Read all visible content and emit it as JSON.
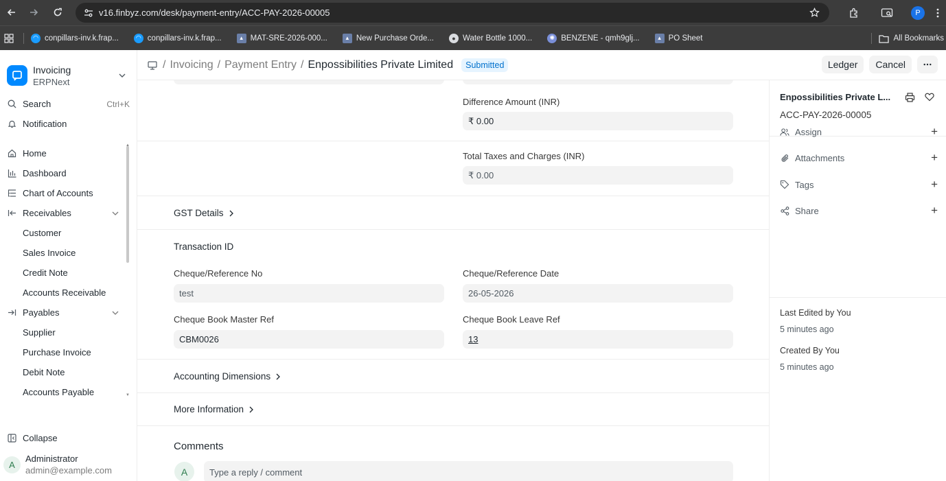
{
  "browser": {
    "url": "v16.finbyz.com/desk/payment-entry/ACC-PAY-2026-00005",
    "profile_initial": "P",
    "bookmarks": [
      {
        "label": "conpillars-inv.k.frap...",
        "color": "#1a9cff"
      },
      {
        "label": "conpillars-inv.k.frap...",
        "color": "#1a9cff"
      },
      {
        "label": "MAT-SRE-2026-000...",
        "color": "#6a7fa8"
      },
      {
        "label": "New Purchase Orde...",
        "color": "#6a7fa8"
      },
      {
        "label": "Water Bottle 1000...",
        "color": "#9aa0a6"
      },
      {
        "label": "BENZENE - qmh9glj...",
        "color": "#7a8fd8"
      },
      {
        "label": "PO Sheet",
        "color": "#6a7fa8"
      }
    ],
    "all_bookmarks": "All Bookmarks"
  },
  "sidebar": {
    "app_title": "Invoicing",
    "app_sub": "ERPNext",
    "search_label": "Search",
    "search_shortcut": "Ctrl+K",
    "notification_label": "Notification",
    "home": "Home",
    "dashboard": "Dashboard",
    "chart_of_accounts": "Chart of Accounts",
    "receivables": "Receivables",
    "receivables_items": [
      "Customer",
      "Sales Invoice",
      "Credit Note",
      "Accounts Receivable"
    ],
    "payables": "Payables",
    "payables_items": [
      "Supplier",
      "Purchase Invoice",
      "Debit Note",
      "Accounts Payable"
    ],
    "collapse": "Collapse",
    "user_initial": "A",
    "user_name": "Administrator",
    "user_email": "admin@example.com"
  },
  "header": {
    "crumb1": "Invoicing",
    "crumb2": "Payment Entry",
    "title": "Enpossibilities Private Limited",
    "status": "Submitted",
    "ledger": "Ledger",
    "cancel": "Cancel"
  },
  "form": {
    "difference_amount_label": "Difference Amount (INR)",
    "difference_amount_value": "₹ 0.00",
    "total_taxes_label": "Total Taxes and Charges (INR)",
    "total_taxes_value": "₹ 0.00",
    "gst_details": "GST Details",
    "transaction_id": "Transaction ID",
    "cheque_ref_no_label": "Cheque/Reference No",
    "cheque_ref_no_value": "test",
    "cheque_ref_date_label": "Cheque/Reference Date",
    "cheque_ref_date_value": "26-05-2026",
    "cheque_book_master_label": "Cheque Book Master Ref",
    "cheque_book_master_value": "CBM0026",
    "cheque_book_leave_label": "Cheque Book Leave Ref",
    "cheque_book_leave_value": "13",
    "accounting_dimensions": "Accounting Dimensions",
    "more_information": "More Information",
    "comments_title": "Comments",
    "comment_avatar": "A",
    "comment_placeholder": "Type a reply / comment"
  },
  "panel": {
    "title": "Enpossibilities Private L...",
    "doc_name": "ACC-PAY-2026-00005",
    "assign": "Assign",
    "attachments": "Attachments",
    "tags": "Tags",
    "share": "Share",
    "last_edited": "Last Edited by You",
    "last_edited_time": "5 minutes ago",
    "created_by": "Created By You",
    "created_time": "5 minutes ago"
  }
}
